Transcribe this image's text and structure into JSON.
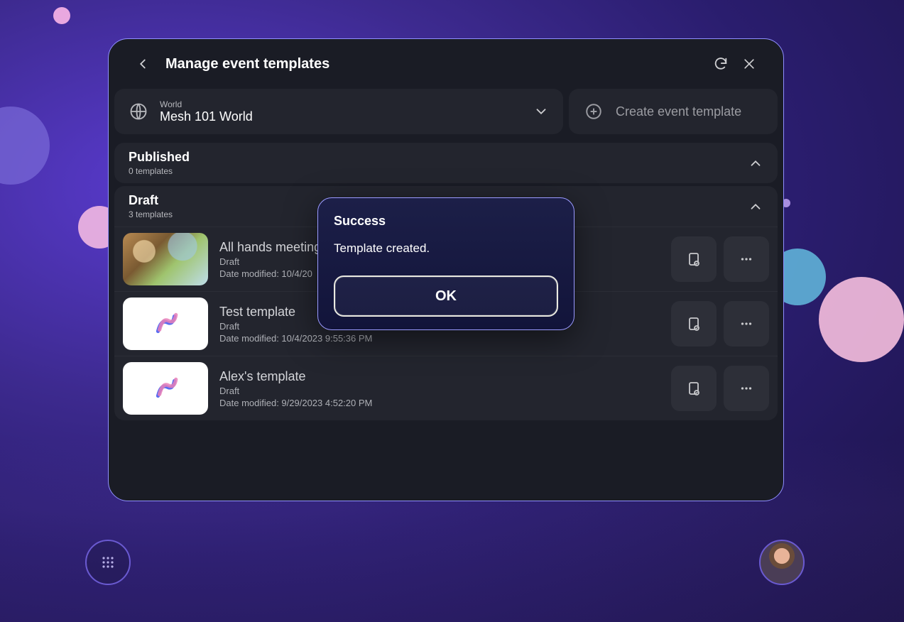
{
  "header": {
    "title": "Manage event templates"
  },
  "world_selector": {
    "label": "World",
    "value": "Mesh 101 World"
  },
  "create_button": {
    "label": "Create event template"
  },
  "sections": {
    "published": {
      "title": "Published",
      "subtitle": "0 templates"
    },
    "draft": {
      "title": "Draft",
      "subtitle": "3 templates"
    }
  },
  "templates": [
    {
      "name": "All hands meeting",
      "status": "Draft",
      "date": "Date modified: 10/4/20"
    },
    {
      "name": "Test template",
      "status": "Draft",
      "date": "Date modified: 10/4/2023 9:55:36 PM"
    },
    {
      "name": "Alex's template",
      "status": "Draft",
      "date": "Date modified: 9/29/2023 4:52:20 PM"
    }
  ],
  "modal": {
    "title": "Success",
    "message": "Template created.",
    "ok": "OK"
  }
}
